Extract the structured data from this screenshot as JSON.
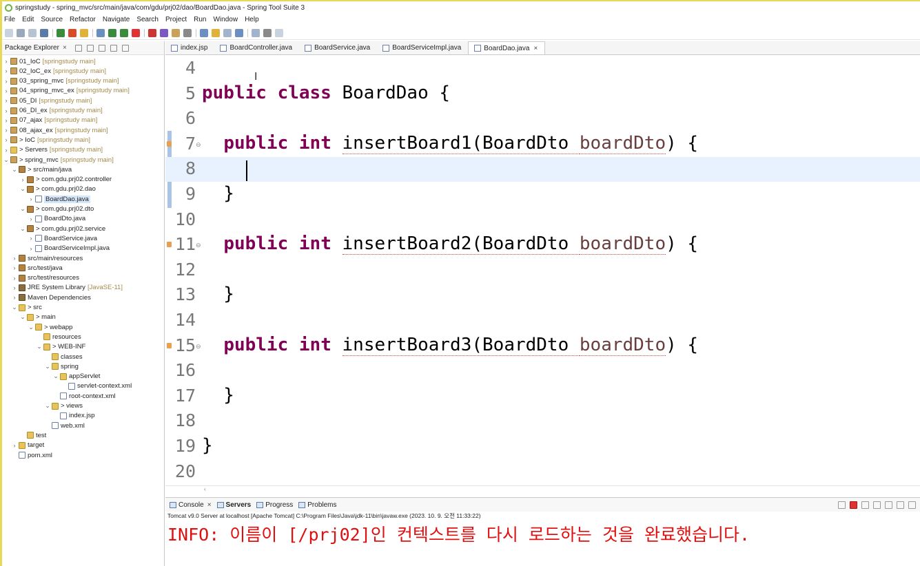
{
  "window": {
    "title": "springstudy - spring_mvc/src/main/java/com/gdu/prj02/dao/BoardDao.java - Spring Tool Suite 3"
  },
  "menu": [
    "File",
    "Edit",
    "Source",
    "Refactor",
    "Navigate",
    "Search",
    "Project",
    "Run",
    "Window",
    "Help"
  ],
  "explorer": {
    "title": "Package Explorer",
    "tree": [
      {
        "label": "01_IoC",
        "qual": "[springstudy main]",
        "depth": 0,
        "arrow": ">",
        "icon": "project"
      },
      {
        "label": "02_IoC_ex",
        "qual": "[springstudy main]",
        "depth": 0,
        "arrow": ">",
        "icon": "project"
      },
      {
        "label": "03_spring_mvc",
        "qual": "[springstudy main]",
        "depth": 0,
        "arrow": ">",
        "icon": "project"
      },
      {
        "label": "04_spring_mvc_ex",
        "qual": "[springstudy main]",
        "depth": 0,
        "arrow": ">",
        "icon": "project"
      },
      {
        "label": "05_DI",
        "qual": "[springstudy main]",
        "depth": 0,
        "arrow": ">",
        "icon": "project"
      },
      {
        "label": "06_DI_ex",
        "qual": "[springstudy main]",
        "depth": 0,
        "arrow": ">",
        "icon": "project"
      },
      {
        "label": "07_ajax",
        "qual": "[springstudy main]",
        "depth": 0,
        "arrow": ">",
        "icon": "project"
      },
      {
        "label": "08_ajax_ex",
        "qual": "[springstudy main]",
        "depth": 0,
        "arrow": ">",
        "icon": "project"
      },
      {
        "label": "> IoC",
        "qual": "[springstudy main]",
        "depth": 0,
        "arrow": ">",
        "icon": "project"
      },
      {
        "label": "> Servers",
        "qual": "[springstudy main]",
        "depth": 0,
        "arrow": ">",
        "icon": "folder"
      },
      {
        "label": "> spring_mvc",
        "qual": "[springstudy main]",
        "depth": 0,
        "arrow": "v",
        "icon": "project"
      },
      {
        "label": "> src/main/java",
        "qual": "",
        "depth": 1,
        "arrow": "v",
        "icon": "package"
      },
      {
        "label": "> com.gdu.prj02.controller",
        "qual": "",
        "depth": 2,
        "arrow": ">",
        "icon": "package"
      },
      {
        "label": "> com.gdu.prj02.dao",
        "qual": "",
        "depth": 2,
        "arrow": "v",
        "icon": "package"
      },
      {
        "label": "BoardDao.java",
        "qual": "",
        "depth": 3,
        "arrow": ">",
        "icon": "file",
        "selected": true
      },
      {
        "label": "> com.gdu.prj02.dto",
        "qual": "",
        "depth": 2,
        "arrow": "v",
        "icon": "package"
      },
      {
        "label": "BoardDto.java",
        "qual": "",
        "depth": 3,
        "arrow": ">",
        "icon": "file"
      },
      {
        "label": "> com.gdu.prj02.service",
        "qual": "",
        "depth": 2,
        "arrow": "v",
        "icon": "package"
      },
      {
        "label": "BoardService.java",
        "qual": "",
        "depth": 3,
        "arrow": ">",
        "icon": "file"
      },
      {
        "label": "BoardServiceImpl.java",
        "qual": "",
        "depth": 3,
        "arrow": ">",
        "icon": "file"
      },
      {
        "label": "src/main/resources",
        "qual": "",
        "depth": 1,
        "arrow": ">",
        "icon": "package"
      },
      {
        "label": "src/test/java",
        "qual": "",
        "depth": 1,
        "arrow": ">",
        "icon": "package"
      },
      {
        "label": "src/test/resources",
        "qual": "",
        "depth": 1,
        "arrow": ">",
        "icon": "package"
      },
      {
        "label": "JRE System Library",
        "qual": "[JavaSE-11]",
        "depth": 1,
        "arrow": ">",
        "icon": "lib"
      },
      {
        "label": "Maven Dependencies",
        "qual": "",
        "depth": 1,
        "arrow": ">",
        "icon": "lib"
      },
      {
        "label": "> src",
        "qual": "",
        "depth": 1,
        "arrow": "v",
        "icon": "folder"
      },
      {
        "label": "> main",
        "qual": "",
        "depth": 2,
        "arrow": "v",
        "icon": "folder"
      },
      {
        "label": "> webapp",
        "qual": "",
        "depth": 3,
        "arrow": "v",
        "icon": "folder"
      },
      {
        "label": "resources",
        "qual": "",
        "depth": 4,
        "arrow": "",
        "icon": "folder"
      },
      {
        "label": "> WEB-INF",
        "qual": "",
        "depth": 4,
        "arrow": "v",
        "icon": "folder"
      },
      {
        "label": "classes",
        "qual": "",
        "depth": 5,
        "arrow": "",
        "icon": "folder"
      },
      {
        "label": "spring",
        "qual": "",
        "depth": 5,
        "arrow": "v",
        "icon": "folder"
      },
      {
        "label": "appServlet",
        "qual": "",
        "depth": 6,
        "arrow": "v",
        "icon": "folder"
      },
      {
        "label": "servlet-context.xml",
        "qual": "",
        "depth": 7,
        "arrow": "",
        "icon": "file"
      },
      {
        "label": "root-context.xml",
        "qual": "",
        "depth": 6,
        "arrow": "",
        "icon": "file"
      },
      {
        "label": "> views",
        "qual": "",
        "depth": 5,
        "arrow": "v",
        "icon": "folder"
      },
      {
        "label": "index.jsp",
        "qual": "",
        "depth": 6,
        "arrow": "",
        "icon": "file"
      },
      {
        "label": "web.xml",
        "qual": "",
        "depth": 5,
        "arrow": "",
        "icon": "file"
      },
      {
        "label": "test",
        "qual": "",
        "depth": 2,
        "arrow": "",
        "icon": "folder"
      },
      {
        "label": "target",
        "qual": "",
        "depth": 1,
        "arrow": ">",
        "icon": "folder"
      },
      {
        "label": "pom.xml",
        "qual": "",
        "depth": 1,
        "arrow": "",
        "icon": "file"
      }
    ]
  },
  "editor": {
    "tabs": [
      {
        "label": "index.jsp",
        "active": false
      },
      {
        "label": "BoardController.java",
        "active": false
      },
      {
        "label": "BoardService.java",
        "active": false
      },
      {
        "label": "BoardServiceImpl.java",
        "active": false
      },
      {
        "label": "BoardDao.java",
        "active": true
      }
    ],
    "lines": [
      {
        "n": "4",
        "segs": []
      },
      {
        "n": "5",
        "segs": [
          {
            "t": "public class",
            "c": "kw"
          },
          {
            "t": " BoardDao {",
            "c": ""
          }
        ]
      },
      {
        "n": "6",
        "segs": []
      },
      {
        "n": "7",
        "fold": true,
        "marker": true,
        "segs": [
          {
            "t": "  ",
            "c": ""
          },
          {
            "t": "public int",
            "c": "kw"
          },
          {
            "t": " ",
            "c": ""
          },
          {
            "t": "insertBoard1(BoardDto ",
            "c": "sq"
          },
          {
            "t": "boardDto",
            "c": "param sq"
          },
          {
            "t": ") {",
            "c": ""
          }
        ]
      },
      {
        "n": "8",
        "current": true,
        "segs": []
      },
      {
        "n": "9",
        "segs": [
          {
            "t": "  }",
            "c": ""
          }
        ]
      },
      {
        "n": "10",
        "segs": []
      },
      {
        "n": "11",
        "fold": true,
        "marker": true,
        "segs": [
          {
            "t": "  ",
            "c": ""
          },
          {
            "t": "public int",
            "c": "kw"
          },
          {
            "t": " ",
            "c": ""
          },
          {
            "t": "insertBoard2(BoardDto ",
            "c": "sq"
          },
          {
            "t": "boardDto",
            "c": "param sq"
          },
          {
            "t": ") {",
            "c": ""
          }
        ]
      },
      {
        "n": "12",
        "segs": []
      },
      {
        "n": "13",
        "segs": [
          {
            "t": "  }",
            "c": ""
          }
        ]
      },
      {
        "n": "14",
        "segs": []
      },
      {
        "n": "15",
        "fold": true,
        "marker": true,
        "segs": [
          {
            "t": "  ",
            "c": ""
          },
          {
            "t": "public int",
            "c": "kw"
          },
          {
            "t": " ",
            "c": ""
          },
          {
            "t": "insertBoard3(BoardDto ",
            "c": "sq"
          },
          {
            "t": "boardDto",
            "c": "param sq"
          },
          {
            "t": ") {",
            "c": ""
          }
        ]
      },
      {
        "n": "16",
        "segs": []
      },
      {
        "n": "17",
        "segs": [
          {
            "t": "  }",
            "c": ""
          }
        ]
      },
      {
        "n": "18",
        "segs": []
      },
      {
        "n": "19",
        "segs": [
          {
            "t": "}",
            "c": ""
          }
        ]
      },
      {
        "n": "20",
        "segs": []
      }
    ]
  },
  "console": {
    "tabs": [
      {
        "label": "Console",
        "active": false,
        "closable": true
      },
      {
        "label": "Servers",
        "active": true,
        "closable": false
      },
      {
        "label": "Progress",
        "active": false,
        "closable": false
      },
      {
        "label": "Problems",
        "active": false,
        "closable": false
      }
    ],
    "description": "Tomcat v9.0 Server at localhost [Apache Tomcat] C:\\Program Files\\Java\\jdk-11\\bin\\javaw.exe  (2023. 10. 9. 오전 11:33:22)",
    "output": "INFO: 이름이 [/prj02]인 컨텍스트를 다시 로드하는 것을 완료했습니다."
  },
  "colors": {
    "keyword": "#7f0055",
    "param": "#6a3e3e",
    "console_text": "#e01010",
    "selection": "#d6e6fa",
    "current_line": "#e8f2fe"
  }
}
